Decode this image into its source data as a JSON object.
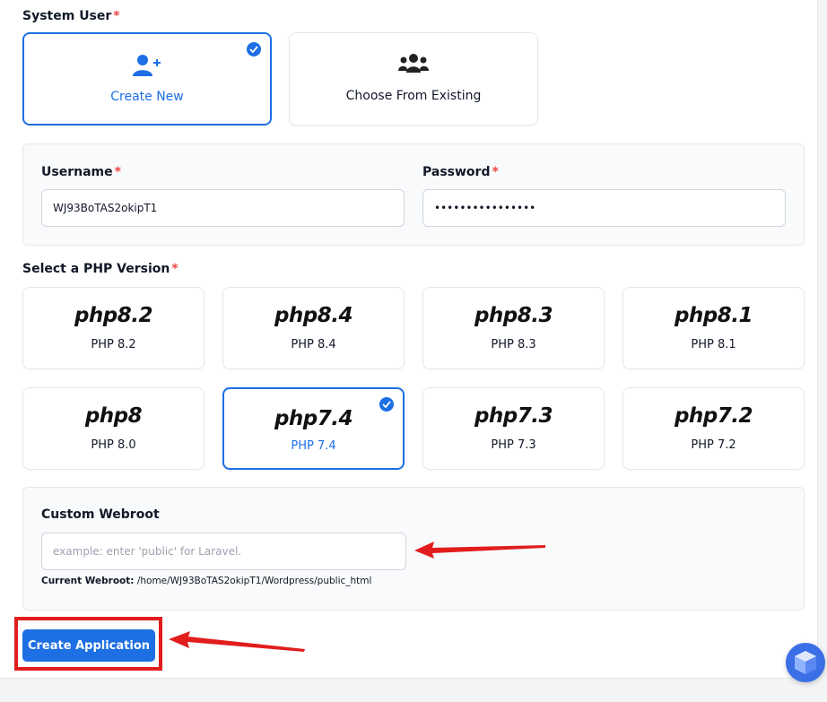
{
  "system_user": {
    "label": "System User",
    "required_mark": "*",
    "options": [
      {
        "label": "Create New",
        "icon": "user-plus-icon",
        "selected": true
      },
      {
        "label": "Choose From Existing",
        "icon": "users-icon",
        "selected": false
      }
    ]
  },
  "credentials": {
    "username_label": "Username",
    "username_value": "WJ93BoTAS2okipT1",
    "password_label": "Password",
    "password_value": "••••••••••••••••",
    "required_mark": "*"
  },
  "php": {
    "label": "Select a PHP Version",
    "required_mark": "*",
    "versions": [
      {
        "logo_prefix": "php",
        "logo_digit": "8",
        "logo_suffix": ".2",
        "name": "PHP 8.2",
        "selected": false
      },
      {
        "logo_prefix": "php",
        "logo_digit": "8",
        "logo_suffix": ".4",
        "name": "PHP 8.4",
        "selected": false
      },
      {
        "logo_prefix": "php",
        "logo_digit": "8",
        "logo_suffix": ".3",
        "name": "PHP 8.3",
        "selected": false
      },
      {
        "logo_prefix": "php",
        "logo_digit": "8",
        "logo_suffix": ".1",
        "name": "PHP 8.1",
        "selected": false
      },
      {
        "logo_prefix": "php",
        "logo_digit": "8",
        "logo_suffix": "",
        "name": "PHP 8.0",
        "selected": false
      },
      {
        "logo_prefix": "php",
        "logo_digit": "7",
        "logo_suffix": ".4",
        "name": "PHP 7.4",
        "selected": true
      },
      {
        "logo_prefix": "php",
        "logo_digit": "7",
        "logo_suffix": ".3",
        "name": "PHP 7.3",
        "selected": false
      },
      {
        "logo_prefix": "php",
        "logo_digit": "7",
        "logo_suffix": ".2",
        "name": "PHP 7.2",
        "selected": false
      }
    ]
  },
  "webroot": {
    "label": "Custom Webroot",
    "placeholder": "example: enter 'public' for Laravel.",
    "value": "",
    "current_label": "Current Webroot:",
    "current_value": "/home/WJ93BoTAS2okipT1/Wordpress/public_html"
  },
  "actions": {
    "create_label": "Create Application"
  },
  "colors": {
    "accent": "#1d6fe3",
    "required": "#ef4444",
    "annotation": "#e11d1d"
  }
}
